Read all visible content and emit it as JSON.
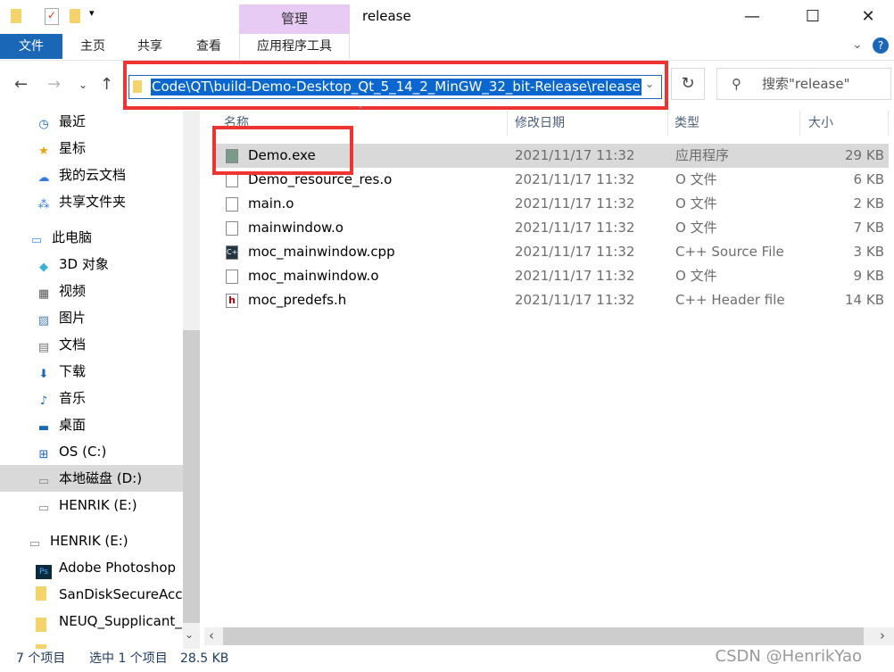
{
  "window": {
    "title": "release",
    "manage_tab": "管理",
    "controls": [
      "minimize",
      "maximize",
      "close"
    ]
  },
  "ribbon": {
    "tabs": [
      "文件",
      "主页",
      "共享",
      "查看",
      "应用程序工具"
    ],
    "expand": "chevron-down",
    "help": "?"
  },
  "address": {
    "path": "Code\\QT\\build-Demo-Desktop_Qt_5_14_2_MinGW_32_bit-Release\\release",
    "search_placeholder": "搜索\"release\""
  },
  "sidebar": {
    "items": [
      {
        "label": "最近",
        "icon": "clock",
        "color": "#1a67b8"
      },
      {
        "label": "星标",
        "icon": "star",
        "color": "#f0a30a"
      },
      {
        "label": "我的云文档",
        "icon": "cloud",
        "color": "#2f7be0"
      },
      {
        "label": "共享文件夹",
        "icon": "share",
        "color": "#2f7be0"
      },
      {
        "label": "此电脑",
        "icon": "computer",
        "color": "#4a90d9"
      },
      {
        "label": "3D 对象",
        "icon": "cube",
        "color": "#3bb0d9"
      },
      {
        "label": "视频",
        "icon": "film",
        "color": "#555"
      },
      {
        "label": "图片",
        "icon": "picture",
        "color": "#4a7fb5"
      },
      {
        "label": "文档",
        "icon": "document",
        "color": "#777"
      },
      {
        "label": "下载",
        "icon": "download",
        "color": "#1a67b8"
      },
      {
        "label": "音乐",
        "icon": "music",
        "color": "#1a67b8"
      },
      {
        "label": "桌面",
        "icon": "desktop",
        "color": "#1a67b8"
      },
      {
        "label": "OS (C:)",
        "icon": "windows-drive",
        "color": "#1a67b8"
      },
      {
        "label": "本地磁盘 (D:)",
        "icon": "drive",
        "color": "#888"
      },
      {
        "label": "HENRIK (E:)",
        "icon": "drive",
        "color": "#888"
      },
      {
        "label": "HENRIK (E:)",
        "icon": "drive",
        "color": "#888"
      },
      {
        "label": "Adobe Photoshop",
        "icon": "photoshop",
        "color": "#0b2a3d"
      },
      {
        "label": "SanDiskSecureAcce",
        "icon": "folder",
        "color": "#f5d36b"
      },
      {
        "label": "NEUQ_Supplicant_F",
        "icon": "zip",
        "color": "#f5d36b"
      },
      {
        "label": "",
        "icon": "zip",
        "color": "#f5d36b"
      }
    ]
  },
  "columns": [
    "名称",
    "修改日期",
    "类型",
    "大小"
  ],
  "files": [
    {
      "name": "Demo.exe",
      "date": "2021/11/17 11:32",
      "type": "应用程序",
      "size": "29 KB",
      "icon": "exe"
    },
    {
      "name": "Demo_resource_res.o",
      "date": "2021/11/17 11:32",
      "type": "O 文件",
      "size": "6 KB",
      "icon": "file"
    },
    {
      "name": "main.o",
      "date": "2021/11/17 11:32",
      "type": "O 文件",
      "size": "2 KB",
      "icon": "file"
    },
    {
      "name": "mainwindow.o",
      "date": "2021/11/17 11:32",
      "type": "O 文件",
      "size": "7 KB",
      "icon": "file"
    },
    {
      "name": "moc_mainwindow.cpp",
      "date": "2021/11/17 11:32",
      "type": "C++ Source File",
      "size": "3 KB",
      "icon": "cpp"
    },
    {
      "name": "moc_mainwindow.o",
      "date": "2021/11/17 11:32",
      "type": "O 文件",
      "size": "9 KB",
      "icon": "file"
    },
    {
      "name": "moc_predefs.h",
      "date": "2021/11/17 11:32",
      "type": "C++ Header file",
      "size": "14 KB",
      "icon": "header"
    }
  ],
  "status": {
    "count": "7 个项目",
    "selected": "选中 1 个项目",
    "size": "28.5 KB"
  },
  "watermark": "CSDN @HenrikYao"
}
